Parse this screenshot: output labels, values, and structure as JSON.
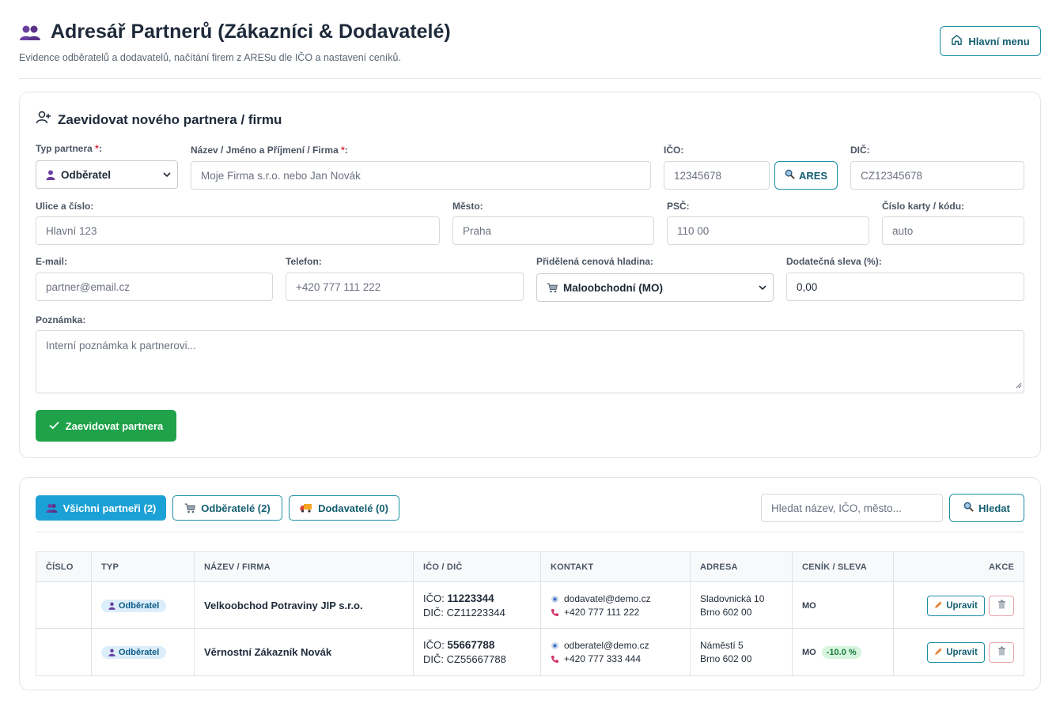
{
  "header": {
    "title": "Adresář Partnerů (Zákazníci & Dodavatelé)",
    "subtitle": "Evidence odběratelů a dodavatelů, načítání firem z ARESu dle IČO a nastavení ceníků.",
    "home_button": "Hlavní menu"
  },
  "form": {
    "title": "Zaevidovat nového partnera / firmu",
    "type": {
      "label": "Typ partnera",
      "req": "*",
      "colon": ":",
      "value": "Odběratel"
    },
    "name": {
      "label": "Název / Jméno a Příjmení / Firma",
      "req": "*",
      "colon": ":",
      "placeholder": "Moje Firma s.r.o. nebo Jan Novák"
    },
    "ico": {
      "label": "IČO:",
      "placeholder": "12345678",
      "button": "ARES"
    },
    "dic": {
      "label": "DIČ:",
      "placeholder": "CZ12345678"
    },
    "street": {
      "label": "Ulice a číslo:",
      "placeholder": "Hlavní 123"
    },
    "city": {
      "label": "Město:",
      "placeholder": "Praha"
    },
    "zip": {
      "label": "PSČ:",
      "placeholder": "110 00"
    },
    "card": {
      "label": "Číslo karty / kódu:",
      "placeholder": "auto"
    },
    "email": {
      "label": "E-mail:",
      "placeholder": "partner@email.cz"
    },
    "phone": {
      "label": "Telefon:",
      "placeholder": "+420 777 111 222"
    },
    "price_level": {
      "label": "Přidělená cenová hladina:",
      "value": "Maloobchodní (MO)"
    },
    "discount": {
      "label": "Dodatečná sleva (%):",
      "value": "0,00"
    },
    "note": {
      "label": "Poznámka:",
      "placeholder": "Interní poznámka k partnerovi..."
    },
    "submit": "Zaevidovat partnera"
  },
  "list": {
    "tabs": [
      {
        "label": "Všichni partneři (2)",
        "icon": "users-icon",
        "active": true
      },
      {
        "label": "Odběratelé (2)",
        "icon": "cart-icon",
        "active": false
      },
      {
        "label": "Dodavatelé (0)",
        "icon": "truck-icon",
        "active": false
      }
    ],
    "search_placeholder": "Hledat název, IČO, město...",
    "search_button": "Hledat",
    "columns": [
      "Číslo",
      "Typ",
      "Název / Firma",
      "IČO / DIČ",
      "Kontakt",
      "Adresa",
      "Ceník / Sleva",
      "Akce"
    ],
    "rows": [
      {
        "number": "",
        "type": "Odběratel",
        "name": "Velkoobchod Potraviny JIP s.r.o.",
        "ico_label": "IČO:",
        "ico": "11223344",
        "dic_label": "DIČ:",
        "dic": "CZ11223344",
        "email": "dodavatel@demo.cz",
        "phone": "+420 777 111 222",
        "street": "Sladovnická 10",
        "city": "Brno 602 00",
        "cenik": "MO",
        "discount": "",
        "edit": "Upravit"
      },
      {
        "number": "",
        "type": "Odběratel",
        "name": "Věrnostní Zákazník Novák",
        "ico_label": "IČO:",
        "ico": "55667788",
        "dic_label": "DIČ:",
        "dic": "CZ55667788",
        "email": "odberatel@demo.cz",
        "phone": "+420 777 333 444",
        "street": "Náměstí 5",
        "city": "Brno 602 00",
        "cenik": "MO",
        "discount": "-10.0 %",
        "edit": "Upravit"
      }
    ]
  },
  "colors": {
    "accent": "#1ba1d6",
    "outline": "#1b8fa8",
    "success": "#1fa34a",
    "danger": "#d9263b"
  }
}
